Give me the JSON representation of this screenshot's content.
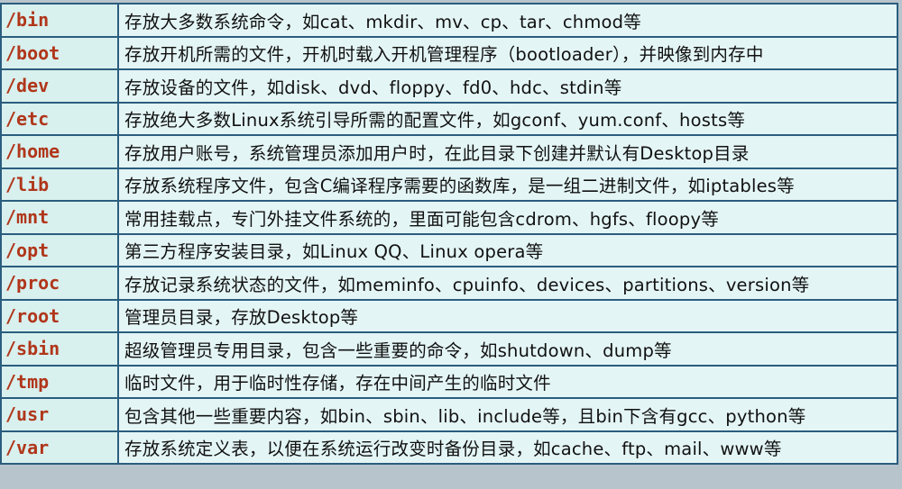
{
  "rows": [
    {
      "path": "/bin",
      "desc": "存放大多数系统命令，如cat、mkdir、mv、cp、tar、chmod等"
    },
    {
      "path": "/boot",
      "desc": "存放开机所需的文件，开机时载入开机管理程序（bootloader），并映像到内存中"
    },
    {
      "path": "/dev",
      "desc": "存放设备的文件，如disk、dvd、floppy、fd0、hdc、stdin等"
    },
    {
      "path": "/etc",
      "desc": "存放绝大多数Linux系统引导所需的配置文件，如gconf、yum.conf、hosts等"
    },
    {
      "path": "/home",
      "desc": "存放用户账号，系统管理员添加用户时，在此目录下创建并默认有Desktop目录"
    },
    {
      "path": "/lib",
      "desc": "存放系统程序文件，包含C编译程序需要的函数库，是一组二进制文件，如iptables等"
    },
    {
      "path": "/mnt",
      "desc": "常用挂载点，专门外挂文件系统的，里面可能包含cdrom、hgfs、floopy等"
    },
    {
      "path": "/opt",
      "desc": "第三方程序安装目录，如Linux QQ、Linux opera等"
    },
    {
      "path": "/proc",
      "desc": "存放记录系统状态的文件，如meminfo、cpuinfo、devices、partitions、version等"
    },
    {
      "path": "/root",
      "desc": "管理员目录，存放Desktop等"
    },
    {
      "path": "/sbin",
      "desc": "超级管理员专用目录，包含一些重要的命令，如shutdown、dump等"
    },
    {
      "path": "/tmp",
      "desc": "临时文件，用于临时性存储，存在中间产生的临时文件"
    },
    {
      "path": "/usr",
      "desc": "包含其他一些重要内容，如bin、sbin、lib、include等，且bin下含有gcc、python等"
    },
    {
      "path": "/var",
      "desc": "存放系统定义表，以便在系统运行改变时备份目录，如cache、ftp、mail、www等"
    }
  ],
  "colors": {
    "path_text": "#b0361a",
    "border": "#2b5d7e",
    "cell_bg": "#e4f5f5"
  }
}
